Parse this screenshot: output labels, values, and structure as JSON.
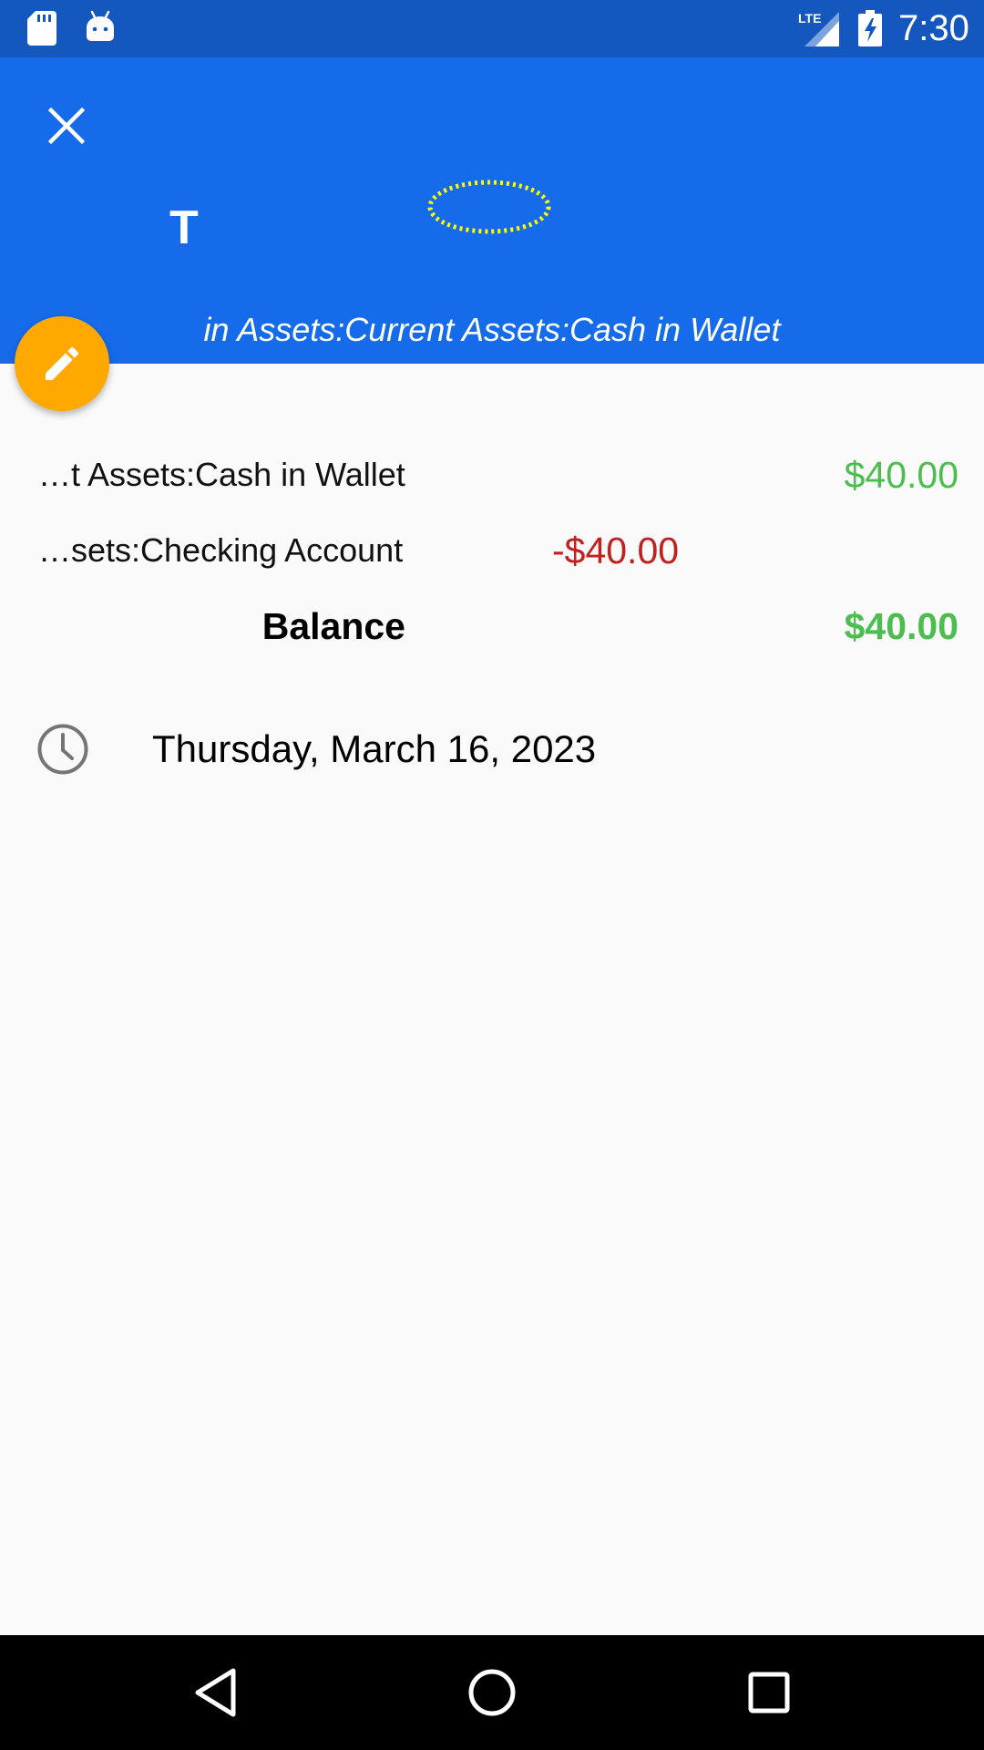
{
  "status_bar": {
    "time": "7:30",
    "network": "LTE",
    "icons": [
      "sd-card-icon",
      "android-icon",
      "lte-signal-icon",
      "battery-charging-icon"
    ]
  },
  "app_bar": {
    "close_icon": "close-icon",
    "title": "T",
    "subtitle": "in Assets:Current Assets:Cash in Wallet",
    "colors": {
      "background": "#166BEA",
      "status_bar": "#1457BF",
      "focus_ring": "#FFFF00"
    }
  },
  "fab": {
    "icon": "pencil-icon",
    "color": "#FFA800"
  },
  "splits": [
    {
      "account": "…t Assets:Cash in Wallet",
      "amount": "$40.00",
      "type": "debit"
    },
    {
      "account": "…sets:Checking Account",
      "amount": "-$40.00",
      "type": "credit"
    }
  ],
  "balance": {
    "label": "Balance",
    "amount": "$40.00"
  },
  "colors": {
    "positive": "#4CBD4F",
    "negative": "#C1211E"
  },
  "date": {
    "icon": "clock-icon",
    "text": "Thursday, March 16, 2023"
  },
  "nav_bar": {
    "icons": [
      "back-icon",
      "home-icon",
      "recents-icon"
    ]
  }
}
